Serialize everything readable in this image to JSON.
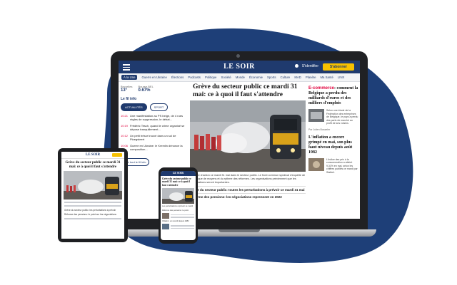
{
  "brand": {
    "name": "LE SOIR",
    "colors": {
      "navy": "#1f3a6e",
      "blob": "#1e3f78",
      "yellow": "#f6c000",
      "red": "#e0003c"
    }
  },
  "laptop": {
    "header": {
      "login": "S'identifier",
      "subscribe": "S'abonner",
      "menu_icon": "hamburger-icon"
    },
    "nav": [
      "À la Une",
      "Guerre en Ukraine",
      "Élections",
      "Podcasts",
      "Politique",
      "Société",
      "Monde",
      "Économie",
      "Sports",
      "Culture",
      "MAD",
      "Planète",
      "Ma Santé",
      "LINX"
    ],
    "weather": {
      "weather_label": "Bruxelles",
      "weather_value": "13°",
      "markets_label": "Bourse BEL",
      "markets_value": "0.67%"
    },
    "feed": {
      "title": "Le fil info",
      "tabs": [
        "ACTUALITÉS",
        "SPORT"
      ],
      "items": [
        {
          "time": "10:21",
          "text": "Une manifestation au PS belge, de 4 rues règles de suppression, le débat..."
        },
        {
          "time": "10:19",
          "text": "Frédéric Tesch, quand le crime organisé se dépose tranquillement..."
        },
        {
          "time": "10:12",
          "text": "Un petit trésor trouvé dans un sol de Ploegsteert"
        },
        {
          "time": "10:06",
          "text": "Guerre en Ukraine: le Kremlin dénonce la composition..."
        }
      ],
      "see_all": "Voir tout le fil info"
    },
    "main": {
      "headline": "Grève du secteur public ce mardi 31 mai: ce à quoi il faut s'attendre",
      "lead": "Journée d'action ce mardi 31 mai dans le secteur public. Le front commun syndical s'inquiète de la manque de moyens et du rythme des réformes. Les organisations préviennent que les perturbations seront importantes.",
      "link1": "Grève du secteur public: toutes les perturbations à prévoir ce mardi 31 mai",
      "link2": "Réforme des pensions: les négociations reprennent en 2022"
    },
    "sidebar": [
      {
        "tag": "E-commerce",
        "title": "comment la Belgique a perdu des milliards d'euros et des milliers d'emplois",
        "text": "Selon une étude de la Fédération des entreprises de Belgique, le pays a perdu des parts de marché au profit de ses voisins.",
        "author": "Par Julien Bosseler"
      },
      {
        "tag": "",
        "title": "L'inflation a encore grimpé en mai, son plus haut niveau depuis août 1982",
        "text": "L'indice des prix à la consommation a atteint 9,31% en mai, selon les chiffres publiés ce mardi par Statbel.",
        "author": ""
      }
    ]
  },
  "tablet": {
    "logo": "LE SOIR",
    "headline": "Grève du secteur public ce mardi 31 mai: ce à quoi il faut s'attendre",
    "bullets": [
      "Grève du secteur public: les perturbations à prévoir",
      "Réforme des pensions: le point sur les négociations"
    ]
  },
  "phone": {
    "logo": "LE SOIR",
    "headline": "Grève du secteur public ce mardi 31 mai: ce à quoi il faut s'attendre",
    "bullets": [
      "Les perturbations à prévoir ce mardi",
      "Réforme des pensions: le point",
      "Inflation: un record depuis 1982"
    ]
  }
}
